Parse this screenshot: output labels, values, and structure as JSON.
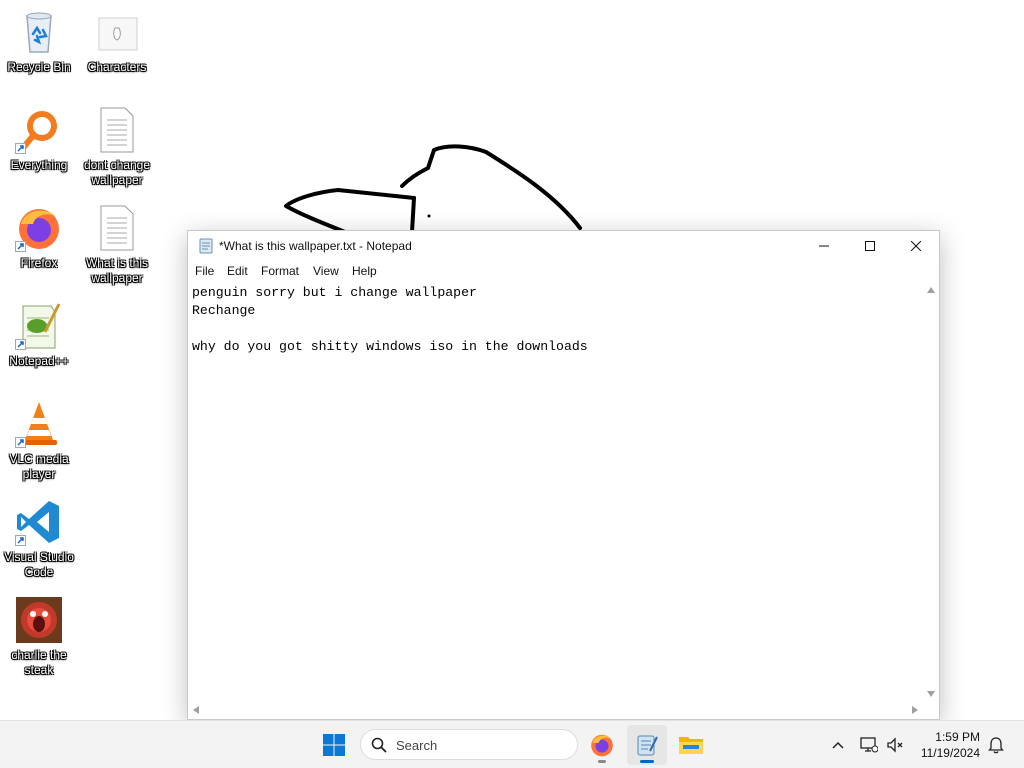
{
  "desktop": {
    "icons": [
      {
        "label": "Recycle Bin",
        "icon": "recycle-bin-icon"
      },
      {
        "label": "Characters",
        "icon": "folder-icon"
      },
      {
        "label": "Everything",
        "icon": "everything-search-icon"
      },
      {
        "label": "dont change wallpaper",
        "icon": "text-file-icon"
      },
      {
        "label": "Firefox",
        "icon": "firefox-icon"
      },
      {
        "label": "What is this wallpaper",
        "icon": "text-file-icon"
      },
      {
        "label": "Notepad++",
        "icon": "notepadpp-icon"
      },
      {
        "label": "VLC media player",
        "icon": "vlc-icon"
      },
      {
        "label": "Visual Studio Code",
        "icon": "vscode-icon"
      },
      {
        "label": "charlie the steak",
        "icon": "charlie-steak-icon"
      }
    ]
  },
  "notepad": {
    "title": "*What is this wallpaper.txt - Notepad",
    "menu": [
      "File",
      "Edit",
      "Format",
      "View",
      "Help"
    ],
    "content": "penguin sorry but i change wallpaper\nRechange\n\nwhy do you got shitty windows iso in the downloads"
  },
  "taskbar": {
    "search_placeholder": "Search",
    "apps": [
      "start-icon",
      "firefox-icon",
      "notepad-icon",
      "file-explorer-icon"
    ],
    "time": "1:59 PM",
    "date": "11/19/2024"
  },
  "colors": {
    "accent": "#0067c0",
    "taskbar_bg": "#f3f3f3"
  }
}
